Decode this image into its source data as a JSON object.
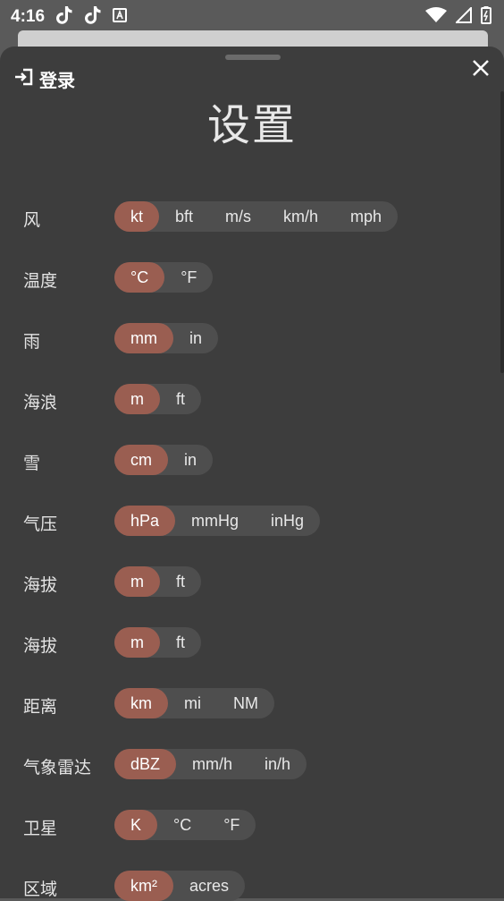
{
  "status_bar": {
    "time": "4:16",
    "left_icons": [
      "tiktok-icon",
      "tiktok-icon",
      "translate-icon"
    ],
    "right_icons": [
      "wifi-icon",
      "signal-icon",
      "battery-icon"
    ]
  },
  "sheet": {
    "login_label": "登录",
    "title": "设置",
    "accent_color": "#9a5e51"
  },
  "settings": [
    {
      "label": "风",
      "options": [
        "kt",
        "bft",
        "m/s",
        "km/h",
        "mph"
      ],
      "selected": 0
    },
    {
      "label": "温度",
      "options": [
        "°C",
        "°F"
      ],
      "selected": 0
    },
    {
      "label": "雨",
      "options": [
        "mm",
        "in"
      ],
      "selected": 0
    },
    {
      "label": "海浪",
      "options": [
        "m",
        "ft"
      ],
      "selected": 0
    },
    {
      "label": "雪",
      "options": [
        "cm",
        "in"
      ],
      "selected": 0
    },
    {
      "label": "气压",
      "options": [
        "hPa",
        "mmHg",
        "inHg"
      ],
      "selected": 0
    },
    {
      "label": "海拔",
      "options": [
        "m",
        "ft"
      ],
      "selected": 0
    },
    {
      "label": "海拔",
      "options": [
        "m",
        "ft"
      ],
      "selected": 0
    },
    {
      "label": "距离",
      "options": [
        "km",
        "mi",
        "NM"
      ],
      "selected": 0
    },
    {
      "label": "气象雷达",
      "options": [
        "dBZ",
        "mm/h",
        "in/h"
      ],
      "selected": 0
    },
    {
      "label": "卫星",
      "options": [
        "K",
        "°C",
        "°F"
      ],
      "selected": 0
    },
    {
      "label": "区域",
      "options": [
        "km²",
        "acres"
      ],
      "selected": 0
    }
  ]
}
